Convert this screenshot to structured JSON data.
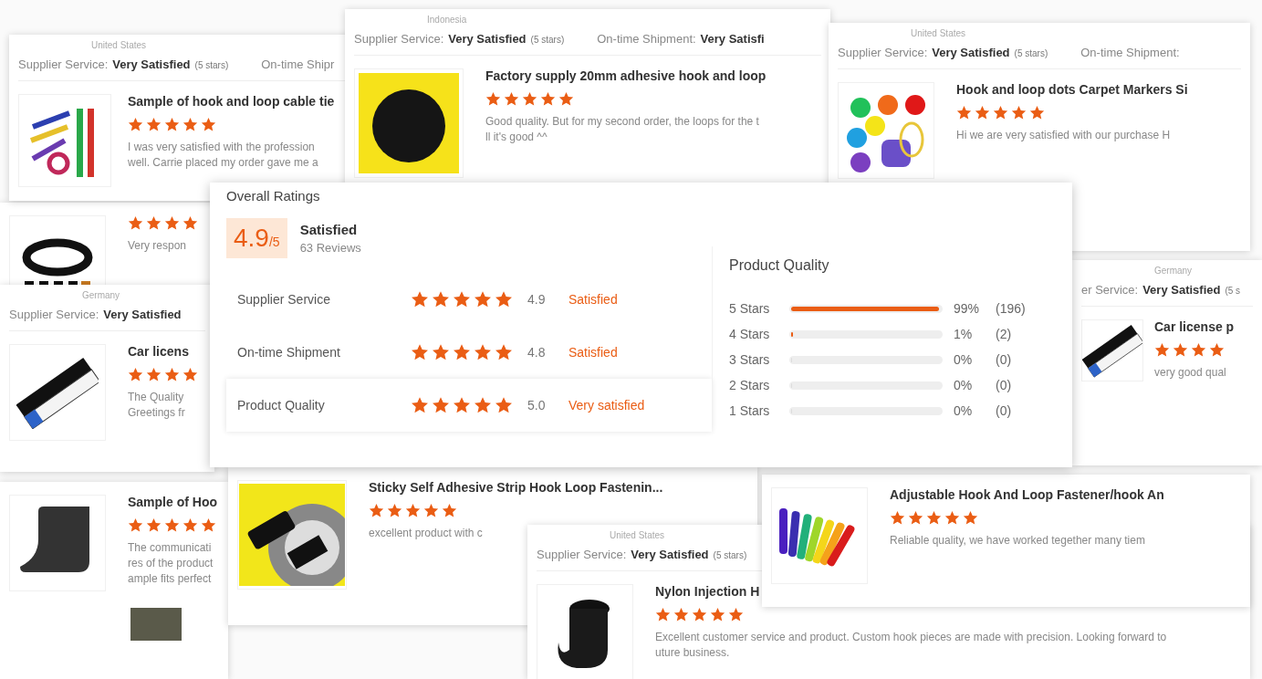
{
  "cards": [
    {
      "location": "Indonesia",
      "ratings": [
        {
          "label": "Supplier Service:",
          "value": "Very Satisfied",
          "note": "(5 stars)"
        },
        {
          "label": "On-time Shipment:",
          "value": "Very Satisfi"
        }
      ],
      "title": "Factory supply 20mm adhesive hook and loop",
      "stars": 5,
      "review": [
        "Good quality. But for my second order, the loops for the t",
        "ll it's good ^^"
      ]
    },
    {
      "location": "United States",
      "ratings": [
        {
          "label": "Supplier Service:",
          "value": "Very Satisfied",
          "note": "(5 stars)"
        },
        {
          "label": "On-time Shipment:"
        }
      ],
      "title": "Hook and loop dots Carpet Markers Si",
      "stars": 5,
      "review": [
        "Hi we are very satisfied with our purchase H"
      ]
    },
    {
      "location": "United States",
      "ratings": [
        {
          "label": "Supplier Service:",
          "value": "Very Satisfied",
          "note": "(5 stars)"
        },
        {
          "label": "On-time Shipr"
        }
      ],
      "title": "Sample of hook and loop cable tie",
      "stars": 5,
      "review": [
        "I was very satisfied with the profession",
        "well.  Carrie placed my order gave me a"
      ]
    },
    {
      "stars": 4,
      "review": [
        "Very respon"
      ]
    },
    {
      "location": "Germany",
      "ratings": [
        {
          "label": "er Service:",
          "value": "Very Satisfied",
          "note": "(5 s"
        }
      ],
      "title": "Car license p",
      "stars": 4,
      "review": [
        "very good qual"
      ]
    },
    {
      "location": "Germany",
      "ratings": [
        {
          "label": "Supplier Service:",
          "value": "Very Satisfied"
        }
      ],
      "title": "Car licens",
      "stars": 4,
      "review": [
        "The Quality",
        "Greetings fr"
      ]
    },
    {
      "title": "Sticky Self Adhesive Strip Hook Loop Fastenin...",
      "stars": 5,
      "review": [
        "excellent product with c"
      ]
    },
    {
      "title": "Adjustable Hook And Loop Fastener/hook An",
      "stars": 5,
      "review": [
        "Reliable  quality, we have worked tegether many tiem"
      ]
    },
    {
      "title": "Sample of Hoo",
      "stars": 5,
      "review": [
        "The communicati",
        "res of the product",
        "ample fits perfect"
      ]
    },
    {
      "location": "United States",
      "ratings": [
        {
          "label": "Supplier Service:",
          "value": "Very Satisfied",
          "note": "(5 stars)"
        }
      ],
      "title": "Nylon Injection H",
      "stars": 5,
      "review": [
        "Excellent customer service and product. Custom hook pieces are made with precision. Looking forward to",
        "uture business."
      ]
    }
  ],
  "overall": {
    "title": "Overall Ratings",
    "score": "4.9",
    "out_of": "/5",
    "verdict": "Satisfied",
    "reviews": "63 Reviews",
    "rows": [
      {
        "label": "Supplier Service",
        "stars": 5,
        "value": "4.9",
        "verdict": "Satisfied",
        "highlighted": false
      },
      {
        "label": "On-time Shipment",
        "stars": 5,
        "value": "4.8",
        "verdict": "Satisfied",
        "highlighted": false
      },
      {
        "label": "Product Quality",
        "stars": 5,
        "value": "5.0",
        "verdict": "Very satisfied",
        "highlighted": true
      }
    ],
    "breakdown_title": "Product Quality",
    "breakdown": [
      {
        "label": "5 Stars",
        "level": 0.99,
        "percent": "99%",
        "count": "(196)"
      },
      {
        "label": "4 Stars",
        "level": 0.01,
        "percent": "1%",
        "count": "(2)"
      },
      {
        "label": "3 Stars",
        "level": 0,
        "percent": "0%",
        "count": "(0)"
      },
      {
        "label": "2 Stars",
        "level": 0,
        "percent": "0%",
        "count": "(0)"
      },
      {
        "label": "1 Stars",
        "level": 0,
        "percent": "0%",
        "count": "(0)"
      }
    ]
  }
}
